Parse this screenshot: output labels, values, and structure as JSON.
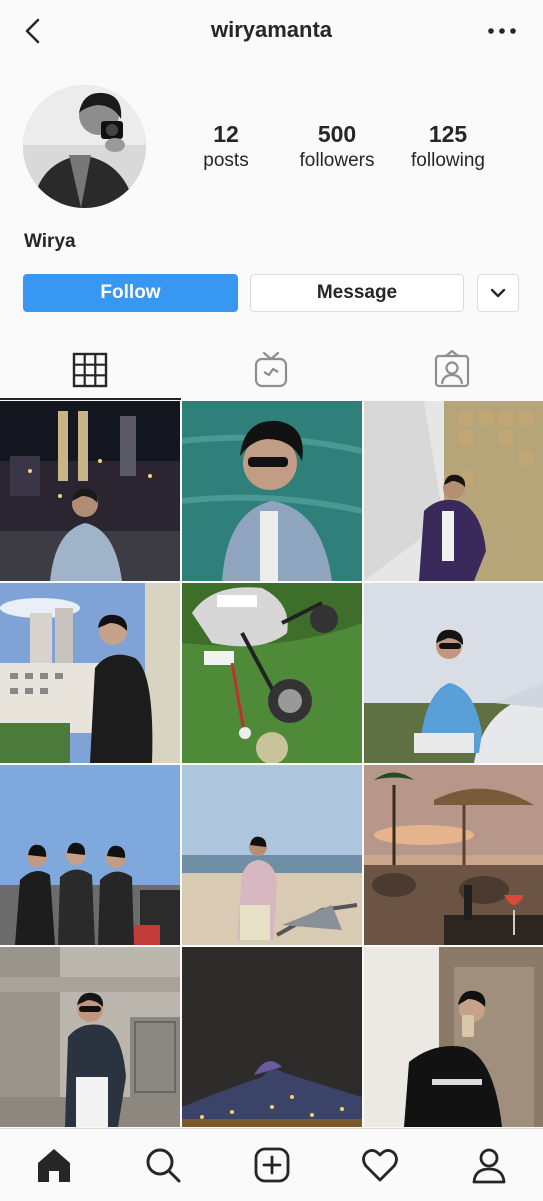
{
  "header": {
    "username": "wiryamanta"
  },
  "profile": {
    "display_name": "Wirya",
    "stats": [
      {
        "value": "12",
        "label": "posts"
      },
      {
        "value": "500",
        "label": "followers"
      },
      {
        "value": "125",
        "label": "following"
      }
    ]
  },
  "actions": {
    "follow_label": "Follow",
    "message_label": "Message"
  },
  "colors": {
    "accent": "#3897f0",
    "text": "#262626",
    "border": "#dbdbdb",
    "background": "#fafafa"
  },
  "tabs": [
    {
      "icon": "grid-icon",
      "active": true
    },
    {
      "icon": "igtv-icon",
      "active": false
    },
    {
      "icon": "tagged-icon",
      "active": false
    }
  ],
  "posts": [
    {
      "scene": "city-night"
    },
    {
      "scene": "sea-sunglasses"
    },
    {
      "scene": "tile-wall"
    },
    {
      "scene": "balcony-city"
    },
    {
      "scene": "golf-cart"
    },
    {
      "scene": "car-sky"
    },
    {
      "scene": "group-rooftop"
    },
    {
      "scene": "beach"
    },
    {
      "scene": "sunset-cafe"
    },
    {
      "scene": "building-jacket"
    },
    {
      "scene": "night-mountain"
    },
    {
      "scene": "mirror-selfie"
    }
  ],
  "bottom_nav": [
    "home-icon",
    "search-icon",
    "new-post-icon",
    "activity-icon",
    "profile-icon"
  ]
}
